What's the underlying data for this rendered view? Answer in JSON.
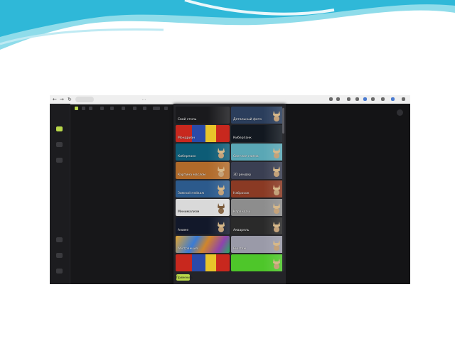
{
  "browser": {
    "url": "...",
    "nav": {
      "back": "←",
      "forward": "→",
      "reload": "↻"
    }
  },
  "styles": [
    {
      "label": "Свой стиль",
      "bg": "#1a1a1d",
      "light": false,
      "cat": false
    },
    {
      "label": "Детальный фото",
      "bg": "#2b3e5c",
      "light": false,
      "cat": true
    },
    {
      "label": "Мондриан",
      "bg": "#c8281e",
      "light": false,
      "cat": false,
      "pattern": "mondrian"
    },
    {
      "label": "Киберпанк",
      "bg": "#121820",
      "light": false,
      "cat": false
    },
    {
      "label": "Киберпанк",
      "bg": "#0d5c76",
      "light": false,
      "cat": true
    },
    {
      "label": "Светлая гамма",
      "bg": "#5aa7b5",
      "light": false,
      "cat": true
    },
    {
      "label": "Картина маслом",
      "bg": "#b06a2a",
      "light": false,
      "cat": true
    },
    {
      "label": "3D рендер",
      "bg": "#3a3f52",
      "light": false,
      "cat": true
    },
    {
      "label": "Зимний пейзаж",
      "bg": "#2c5a8c",
      "light": false,
      "cat": true
    },
    {
      "label": "Набросок",
      "bg": "#8a3a24",
      "light": false,
      "cat": true
    },
    {
      "label": "Минимализм",
      "bg": "#d9d9d9",
      "light": true,
      "cat": true
    },
    {
      "label": "Карандаш",
      "bg": "#8d8d8d",
      "light": false,
      "cat": true
    },
    {
      "label": "Аниме",
      "bg": "#12182a",
      "light": false,
      "cat": true
    },
    {
      "label": "Акварель",
      "bg": "#2a2a2a",
      "light": false,
      "cat": true
    },
    {
      "label": "Абстракция",
      "bg": "#d0862a",
      "light": false,
      "cat": false,
      "pattern": "abstract"
    },
    {
      "label": "Винтаж",
      "bg": "#9a9aa8",
      "light": false,
      "cat": true
    },
    {
      "label": "",
      "bg": "#c8281e",
      "light": false,
      "cat": false,
      "pattern": "mondrian"
    },
    {
      "label": "",
      "bg": "#4ec62a",
      "light": false,
      "cat": true
    }
  ],
  "sidebar": {
    "items": [
      {
        "label": "",
        "active": true
      },
      {
        "label": "",
        "active": false
      },
      {
        "label": "",
        "active": false
      },
      {
        "label": "",
        "active": false
      },
      {
        "label": "",
        "active": false
      },
      {
        "label": "",
        "active": false
      }
    ]
  },
  "apply_label": "Применить",
  "hint": {
    "line1": "",
    "line2": ""
  },
  "colors": {
    "accent": "#b9d84a",
    "panel": "#242428",
    "app_bg": "#171719"
  }
}
